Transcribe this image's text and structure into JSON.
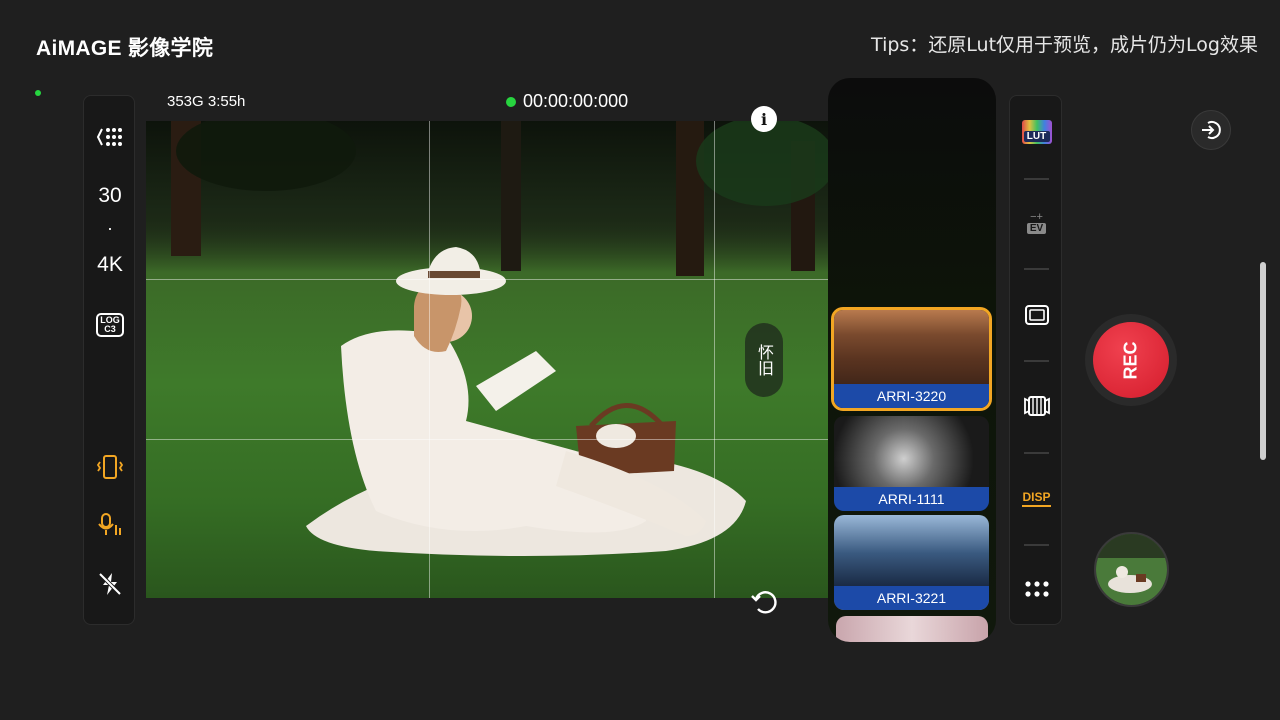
{
  "header": {
    "brand": "AiMAGE 影像学院",
    "tips": "Tips：还原Lut仅用于预览，成片仍为Log效果"
  },
  "status": {
    "storage": "353G  3:55h",
    "timecode": "00:00:00:000"
  },
  "left_toolbar": {
    "fps": "30",
    "separator": "·",
    "resolution": "4K",
    "log_badge_top": "LOG",
    "log_badge_bottom": "C3"
  },
  "viewfinder": {
    "lut_name": "怀旧"
  },
  "lut_strip": {
    "items": [
      {
        "label": "ARRI-3220",
        "selected": true
      },
      {
        "label": "ARRI-1111",
        "selected": false
      },
      {
        "label": "ARRI-3221",
        "selected": false
      }
    ]
  },
  "right_toolbar": {
    "lut_icon_text": "LUT",
    "ev_icon_text": "EV",
    "disp_icon_text": "DISP"
  },
  "record": {
    "label": "REC"
  },
  "colors": {
    "accent_orange": "#f2a623",
    "rec_red": "#e0283a",
    "status_green": "#27d43f",
    "lut_label_blue": "#1c4aa8"
  }
}
